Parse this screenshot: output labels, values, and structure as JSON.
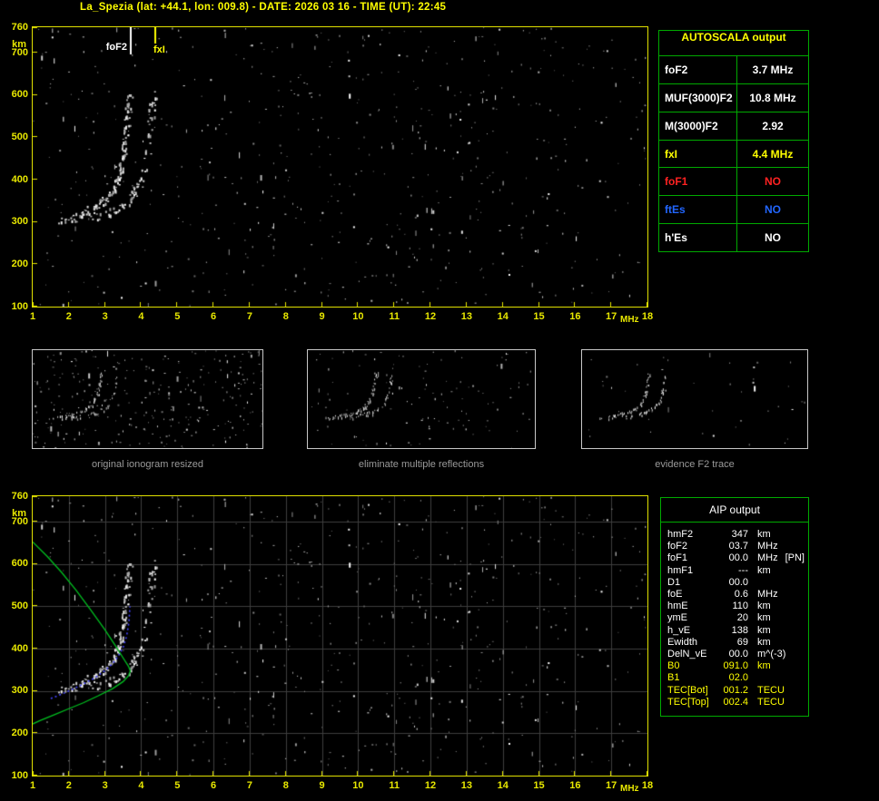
{
  "title": "La_Spezia (lat: +44.1, lon: 009.8) - DATE: 2026 03 16 - TIME (UT): 22:45",
  "axis_units": {
    "x": "MHz",
    "y": "km"
  },
  "colors": {
    "accent_yellow": "#ffff00",
    "table_border_green": "#00aa00",
    "profile_green": "#00c020",
    "fit_blue": "#4444ff",
    "marker_fof2": "#ffffff",
    "marker_fxi": "#ffff00"
  },
  "autoscala": {
    "header": "AUTOSCALA output",
    "rows": [
      {
        "label": "foF2",
        "value": "3.7 MHz",
        "color": "#ffffff"
      },
      {
        "label": "MUF(3000)F2",
        "value": "10.8 MHz",
        "color": "#ffffff"
      },
      {
        "label": "M(3000)F2",
        "value": "2.92",
        "color": "#ffffff"
      },
      {
        "label": "fxI",
        "value": "4.4 MHz",
        "color": "#ffff00"
      },
      {
        "label": "foF1",
        "value": "NO",
        "color": "#ff2222"
      },
      {
        "label": "ftEs",
        "value": "NO",
        "color": "#2266ff"
      },
      {
        "label": "h'Es",
        "value": "NO",
        "color": "#ffffff"
      }
    ]
  },
  "thumbnails": [
    {
      "caption": "original ionogram resized"
    },
    {
      "caption": "eliminate multiple reflections"
    },
    {
      "caption": "evidence F2 trace"
    }
  ],
  "aip": {
    "header": "AIP output",
    "rows": [
      {
        "name": "hmF2",
        "value": "347",
        "unit": "km",
        "color": "#ffffff"
      },
      {
        "name": "foF2",
        "value": "03.7",
        "unit": "MHz",
        "color": "#ffffff"
      },
      {
        "name": "foF1",
        "value": "00.0",
        "unit": "MHz",
        "note": "[PN]",
        "color": "#ffffff"
      },
      {
        "name": "hmF1",
        "value": "---",
        "unit": "km",
        "color": "#ffffff"
      },
      {
        "name": "D1",
        "value": "00.0",
        "unit": "",
        "color": "#ffffff"
      },
      {
        "name": "foE",
        "value": "0.6",
        "unit": "MHz",
        "color": "#ffffff"
      },
      {
        "name": "hmE",
        "value": "110",
        "unit": "km",
        "color": "#ffffff"
      },
      {
        "name": "ymE",
        "value": "20",
        "unit": "km",
        "color": "#ffffff"
      },
      {
        "name": "h_vE",
        "value": "138",
        "unit": "km",
        "color": "#ffffff"
      },
      {
        "name": "Ewidth",
        "value": "69",
        "unit": "km",
        "color": "#ffffff"
      },
      {
        "name": "DelN_vE",
        "value": "00.0",
        "unit": "m^(-3)",
        "color": "#ffffff"
      },
      {
        "name": "B0",
        "value": "091.0",
        "unit": "km",
        "color": "#ffff00"
      },
      {
        "name": "B1",
        "value": "02.0",
        "unit": "",
        "color": "#ffff00"
      },
      {
        "name": "TEC[Bot]",
        "value": "001.2",
        "unit": "TECU",
        "color": "#ffff00"
      },
      {
        "name": "TEC[Top]",
        "value": "002.4",
        "unit": "TECU",
        "color": "#ffff00"
      }
    ]
  },
  "chart_data": [
    {
      "type": "scatter",
      "name": "ionogram",
      "xlabel": "MHz",
      "ylabel": "km",
      "xlim": [
        1,
        18
      ],
      "ylim": [
        100,
        760
      ],
      "xticks": [
        1,
        2,
        3,
        4,
        5,
        6,
        7,
        8,
        9,
        10,
        11,
        12,
        13,
        14,
        15,
        16,
        17,
        18
      ],
      "yticks": [
        760,
        700,
        600,
        500,
        400,
        300,
        200,
        100
      ],
      "grid": false,
      "markers": [
        {
          "label": "foF2",
          "value_mhz": 3.7,
          "color": "#ffffff"
        },
        {
          "label": "fxI",
          "value_mhz": 4.4,
          "color": "#ffff00"
        }
      ],
      "series": [
        {
          "name": "F2-trace-O-mode",
          "points": [
            [
              1.75,
              300
            ],
            [
              2.1,
              310
            ],
            [
              2.3,
              317
            ],
            [
              2.5,
              325
            ],
            [
              2.7,
              334
            ],
            [
              2.9,
              346
            ],
            [
              3.1,
              363
            ],
            [
              3.3,
              390
            ],
            [
              3.45,
              427
            ],
            [
              3.55,
              475
            ],
            [
              3.62,
              538
            ],
            [
              3.67,
              600
            ]
          ]
        },
        {
          "name": "F2-trace-X-mode",
          "points": [
            [
              2.55,
              303
            ],
            [
              2.75,
              310
            ],
            [
              2.95,
              317
            ],
            [
              3.15,
              325
            ],
            [
              3.35,
              334
            ],
            [
              3.55,
              346
            ],
            [
              3.75,
              363
            ],
            [
              3.95,
              390
            ],
            [
              4.1,
              427
            ],
            [
              4.2,
              475
            ],
            [
              4.27,
              538
            ],
            [
              4.32,
              600
            ]
          ]
        }
      ]
    },
    {
      "type": "scatter",
      "name": "ionogram-with-AIP-profile",
      "xlabel": "MHz",
      "ylabel": "km",
      "xlim": [
        1,
        18
      ],
      "ylim": [
        100,
        760
      ],
      "xticks": [
        1,
        2,
        3,
        4,
        5,
        6,
        7,
        8,
        9,
        10,
        11,
        12,
        13,
        14,
        15,
        16,
        17,
        18
      ],
      "yticks": [
        760,
        700,
        600,
        500,
        400,
        300,
        200,
        100
      ],
      "grid": true,
      "series": [
        {
          "name": "F2-trace-O-mode",
          "points": [
            [
              1.75,
              300
            ],
            [
              2.1,
              310
            ],
            [
              2.3,
              317
            ],
            [
              2.5,
              325
            ],
            [
              2.7,
              334
            ],
            [
              2.9,
              346
            ],
            [
              3.1,
              363
            ],
            [
              3.3,
              390
            ],
            [
              3.45,
              427
            ],
            [
              3.55,
              475
            ],
            [
              3.62,
              538
            ],
            [
              3.67,
              600
            ]
          ]
        },
        {
          "name": "F2-trace-X-mode",
          "points": [
            [
              2.55,
              303
            ],
            [
              2.75,
              310
            ],
            [
              2.95,
              317
            ],
            [
              3.15,
              325
            ],
            [
              3.35,
              334
            ],
            [
              3.55,
              346
            ],
            [
              3.75,
              363
            ],
            [
              3.95,
              390
            ],
            [
              4.1,
              427
            ],
            [
              4.2,
              475
            ],
            [
              4.27,
              538
            ],
            [
              4.32,
              600
            ]
          ]
        }
      ],
      "profile": {
        "name": "electron-density-profile",
        "color": "#00c020",
        "points": [
          [
            1.0,
            652
          ],
          [
            1.4,
            618
          ],
          [
            1.8,
            580
          ],
          [
            2.2,
            538
          ],
          [
            2.6,
            492
          ],
          [
            3.0,
            444
          ],
          [
            3.3,
            405
          ],
          [
            3.5,
            378
          ],
          [
            3.65,
            358
          ],
          [
            3.7,
            347
          ],
          [
            3.65,
            336
          ],
          [
            3.5,
            322
          ],
          [
            3.2,
            305
          ],
          [
            2.8,
            288
          ],
          [
            2.4,
            272
          ],
          [
            2.0,
            258
          ],
          [
            1.6,
            244
          ],
          [
            1.2,
            230
          ],
          [
            1.0,
            222
          ]
        ]
      },
      "fit": {
        "name": "autoscala-fitted-trace",
        "color": "#4444ff",
        "points": [
          [
            1.5,
            282
          ],
          [
            1.9,
            296
          ],
          [
            2.3,
            312
          ],
          [
            2.7,
            330
          ],
          [
            3.0,
            348
          ],
          [
            3.2,
            364
          ],
          [
            3.35,
            380
          ],
          [
            3.5,
            402
          ],
          [
            3.6,
            430
          ],
          [
            3.66,
            462
          ],
          [
            3.69,
            500
          ]
        ]
      }
    }
  ]
}
